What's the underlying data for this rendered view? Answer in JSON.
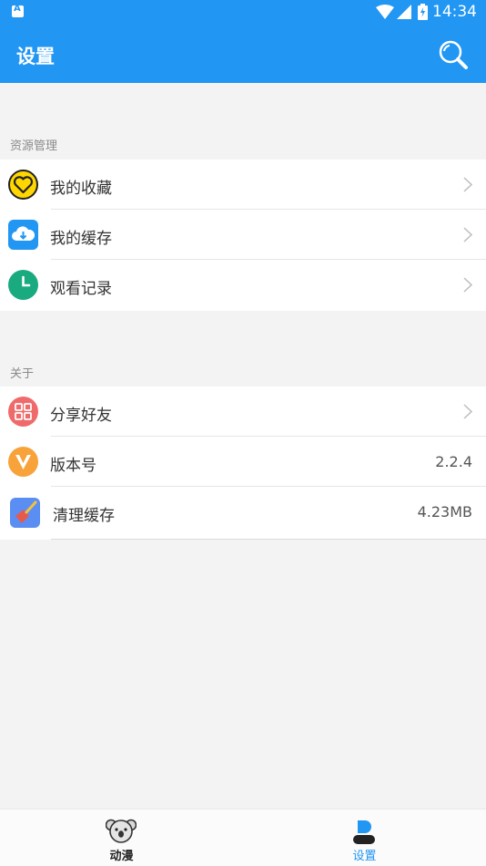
{
  "status": {
    "time": "14:34"
  },
  "header": {
    "title": "设置"
  },
  "sections": [
    {
      "header": "资源管理",
      "items": [
        {
          "label": "我的收藏",
          "icon": "favorite-heart-icon",
          "chevron": true
        },
        {
          "label": "我的缓存",
          "icon": "cloud-download-icon",
          "chevron": true
        },
        {
          "label": "观看记录",
          "icon": "clock-icon",
          "chevron": true
        }
      ]
    },
    {
      "header": "关于",
      "items": [
        {
          "label": "分享好友",
          "icon": "share-grid-icon",
          "chevron": true
        },
        {
          "label": "版本号",
          "icon": "version-v-icon",
          "value": "2.2.4"
        },
        {
          "label": "清理缓存",
          "icon": "broom-icon",
          "value": "4.23MB"
        }
      ]
    }
  ],
  "bottom_nav": {
    "items": [
      {
        "label": "动漫",
        "icon": "koala-icon",
        "active": false
      },
      {
        "label": "设置",
        "icon": "user-icon",
        "active": true
      }
    ]
  },
  "colors": {
    "primary": "#2196f3",
    "background": "#f3f3f3",
    "heart_yellow": "#ffd600",
    "cloud_blue": "#2196f3",
    "clock_green": "#1aaa80",
    "share_red": "#ef6b6b",
    "version_orange": "#f7a33a",
    "broom_blue": "#5b8ef2"
  }
}
